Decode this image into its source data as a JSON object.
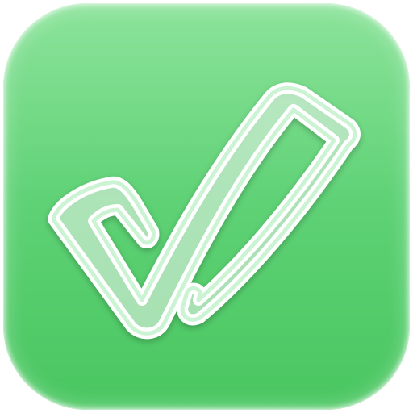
{
  "app_icon": {
    "icon": "checkmark-icon",
    "colors": {
      "background_top": "#7fe08f",
      "background_bottom": "#49c660",
      "check_fill": "#e9fbec",
      "check_stroke": "#ffffff"
    }
  }
}
